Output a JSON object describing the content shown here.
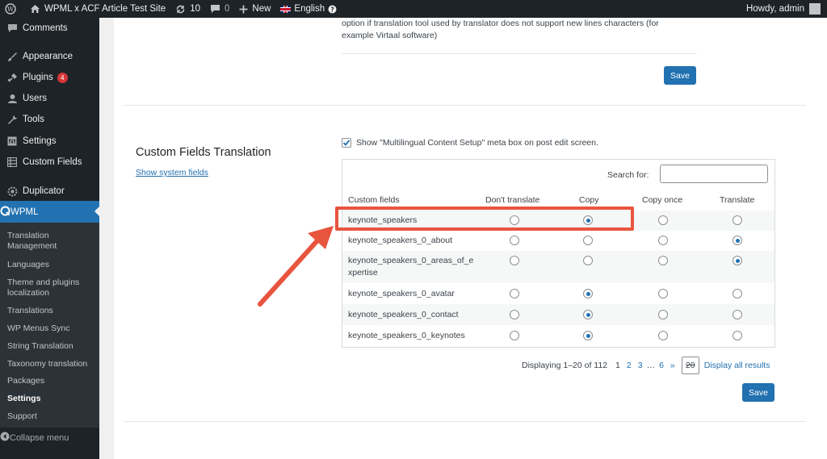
{
  "admin_bar": {
    "site_name": "WPML x ACF Article Test Site",
    "updates_count": "10",
    "comments_count": "0",
    "new_label": "New",
    "language_label": "English",
    "greeting": "Howdy, admin"
  },
  "sidebar": {
    "items": [
      {
        "label": "Comments",
        "icon": "comment-icon"
      },
      {
        "label": "Appearance",
        "icon": "brush-icon"
      },
      {
        "label": "Plugins",
        "icon": "plugin-icon",
        "badge": "4"
      },
      {
        "label": "Users",
        "icon": "user-icon"
      },
      {
        "label": "Tools",
        "icon": "wrench-icon"
      },
      {
        "label": "Settings",
        "icon": "settings-icon"
      },
      {
        "label": "Custom Fields",
        "icon": "grid-icon"
      },
      {
        "label": "Duplicator",
        "icon": "duplicator-icon"
      }
    ],
    "active": {
      "label": "WPML",
      "icon": "wpml-icon"
    },
    "submenu": [
      "Translation Management",
      "Languages",
      "Theme and plugins localization",
      "Translations",
      "WP Menus Sync",
      "String Translation",
      "Taxonomy translation",
      "Packages",
      "Settings",
      "Support"
    ],
    "current_submenu": "Settings",
    "collapse_label": "Collapse menu"
  },
  "top_section": {
    "note": "option if translation tool used by translator does not support new lines characters (for example Virtaal software)",
    "save_label": "Save"
  },
  "custom_fields": {
    "title": "Custom Fields Translation",
    "show_system_link": "Show system fields",
    "meta_box_label": "Show \"Multilingual Content Setup\" meta box on post edit screen.",
    "meta_box_checked": true,
    "search_label": "Search for:",
    "search_value": "",
    "columns": [
      "Custom fields",
      "Don't translate",
      "Copy",
      "Copy once",
      "Translate"
    ],
    "rows": [
      {
        "name": "keynote_speakers",
        "selected": "Copy"
      },
      {
        "name": "keynote_speakers_0_about",
        "selected": "Translate"
      },
      {
        "name": "keynote_speakers_0_areas_of_expertise",
        "selected": "Translate"
      },
      {
        "name": "keynote_speakers_0_avatar",
        "selected": "Copy"
      },
      {
        "name": "keynote_speakers_0_contact",
        "selected": "Copy"
      },
      {
        "name": "keynote_speakers_0_keynotes",
        "selected": "Copy"
      }
    ],
    "pagination": {
      "summary": "Displaying 1–20 of 112",
      "pages": [
        "1",
        "2",
        "3",
        "…",
        "6",
        "»"
      ],
      "current_page": "1",
      "per_page": "20",
      "display_all": "Display all results"
    },
    "save_label": "Save"
  },
  "colors": {
    "admin_dark": "#1d2327",
    "submenu_bg": "#2c3338",
    "accent": "#2271b1",
    "annotation": "#e8553f"
  }
}
